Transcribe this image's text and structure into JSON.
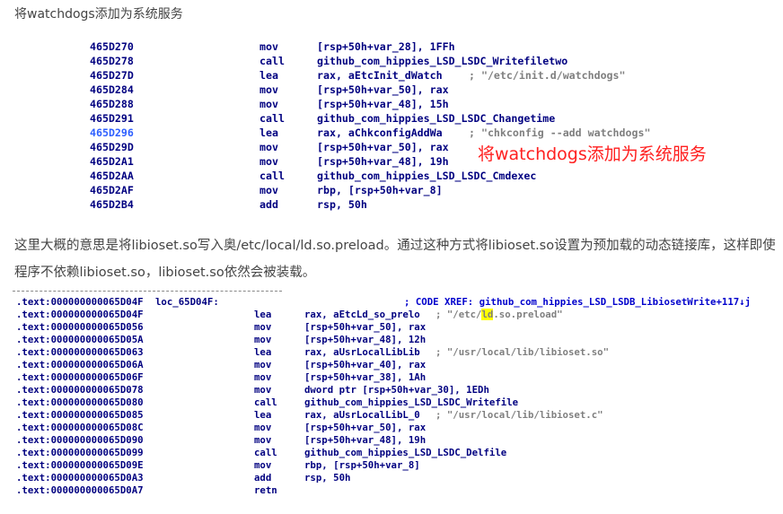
{
  "heading": "将watchdogs添加为系统服务",
  "overlay_note": "将watchdogs添加为系统服务",
  "paragraph": "这里大概的意思是将libioset.so写入奥/etc/local/ld.so.preload。通过这种方式将libioset.so设置为预加载的动态链接库，这样即使程序不依赖libioset.so，libioset.so依然会被装载。",
  "asm_block_1": [
    {
      "addr": "465D270",
      "op": "mov",
      "arg": "[rsp+50h+var_28], 1FFh",
      "cmt": ""
    },
    {
      "addr": "465D278",
      "op": "call",
      "arg": "github_com_hippies_LSD_LSDC_Writefiletwo",
      "cmt": ""
    },
    {
      "addr": "465D27D",
      "op": "lea",
      "arg": "rax, aEtcInit_dWatch",
      "cmt": "; \"/etc/init.d/watchdogs\""
    },
    {
      "addr": "465D284",
      "op": "mov",
      "arg": "[rsp+50h+var_50], rax",
      "cmt": ""
    },
    {
      "addr": "465D288",
      "op": "mov",
      "arg": "[rsp+50h+var_48], 15h",
      "cmt": ""
    },
    {
      "addr": "465D291",
      "op": "call",
      "arg": "github_com_hippies_LSD_LSDC_Changetime",
      "cmt": ""
    },
    {
      "addr": "465D296",
      "op": "lea",
      "arg": "rax, aChkconfigAddWa",
      "cmt": "; \"chkconfig --add watchdogs\""
    },
    {
      "addr": "465D29D",
      "op": "mov",
      "arg": "[rsp+50h+var_50], rax",
      "cmt": ""
    },
    {
      "addr": "465D2A1",
      "op": "mov",
      "arg": "[rsp+50h+var_48], 19h",
      "cmt": ""
    },
    {
      "addr": "465D2AA",
      "op": "call",
      "arg": "github_com_hippies_LSD_LSDC_Cmdexec",
      "cmt": ""
    },
    {
      "addr": "465D2AF",
      "op": "mov",
      "arg": "rbp, [rsp+50h+var_8]",
      "cmt": ""
    },
    {
      "addr": "465D2B4",
      "op": "add",
      "arg": "rsp, 50h",
      "cmt": ""
    }
  ],
  "asm_block_2_header": {
    "sec": ".text:000000000065D04F",
    "label": "loc_65D04F:",
    "xref": "; CODE XREF: github_com_hippies_LSD_LSDB_LibiosetWrite+117↓j"
  },
  "asm_block_2": [
    {
      "sec": ".text:000000000065D04F",
      "op": "lea",
      "arg": "rax, aEtcLd_so_prelo",
      "cmt_pre": "; \"/etc/",
      "cmt_hl": "ld",
      "cmt_post": ".so.preload\""
    },
    {
      "sec": ".text:000000000065D056",
      "op": "mov",
      "arg": "[rsp+50h+var_50], rax"
    },
    {
      "sec": ".text:000000000065D05A",
      "op": "mov",
      "arg": "[rsp+50h+var_48], 12h"
    },
    {
      "sec": ".text:000000000065D063",
      "op": "lea",
      "arg": "rax, aUsrLocalLibLib",
      "cmt_pre": "; \"/usr/local/lib/libioset.so\""
    },
    {
      "sec": ".text:000000000065D06A",
      "op": "mov",
      "arg": "[rsp+50h+var_40], rax"
    },
    {
      "sec": ".text:000000000065D06F",
      "op": "mov",
      "arg": "[rsp+50h+var_38], 1Ah"
    },
    {
      "sec": ".text:000000000065D078",
      "op": "mov",
      "arg": "dword ptr [rsp+50h+var_30], 1EDh"
    },
    {
      "sec": ".text:000000000065D080",
      "op": "call",
      "arg": "github_com_hippies_LSD_LSDC_Writefile"
    },
    {
      "sec": ".text:000000000065D085",
      "op": "lea",
      "arg": "rax, aUsrLocalLibL_0",
      "cmt_pre": "; \"/usr/local/lib/libioset.c\""
    },
    {
      "sec": ".text:000000000065D08C",
      "op": "mov",
      "arg": "[rsp+50h+var_50], rax"
    },
    {
      "sec": ".text:000000000065D090",
      "op": "mov",
      "arg": "[rsp+50h+var_48], 19h"
    },
    {
      "sec": ".text:000000000065D099",
      "op": "call",
      "arg": "github_com_hippies_LSD_LSDC_Delfile"
    },
    {
      "sec": ".text:000000000065D09E",
      "op": "mov",
      "arg": "rbp, [rsp+50h+var_8]"
    },
    {
      "sec": ".text:000000000065D0A3",
      "op": "add",
      "arg": "rsp, 50h"
    },
    {
      "sec": ".text:000000000065D0A7",
      "op": "retn",
      "arg": ""
    }
  ],
  "colors": {
    "asm_text": "#000080",
    "asm_comment": "#7f7f7f",
    "overlay_red": "#ff2020",
    "highlight_yellow": "#ffff00",
    "body_text": "#444444"
  }
}
